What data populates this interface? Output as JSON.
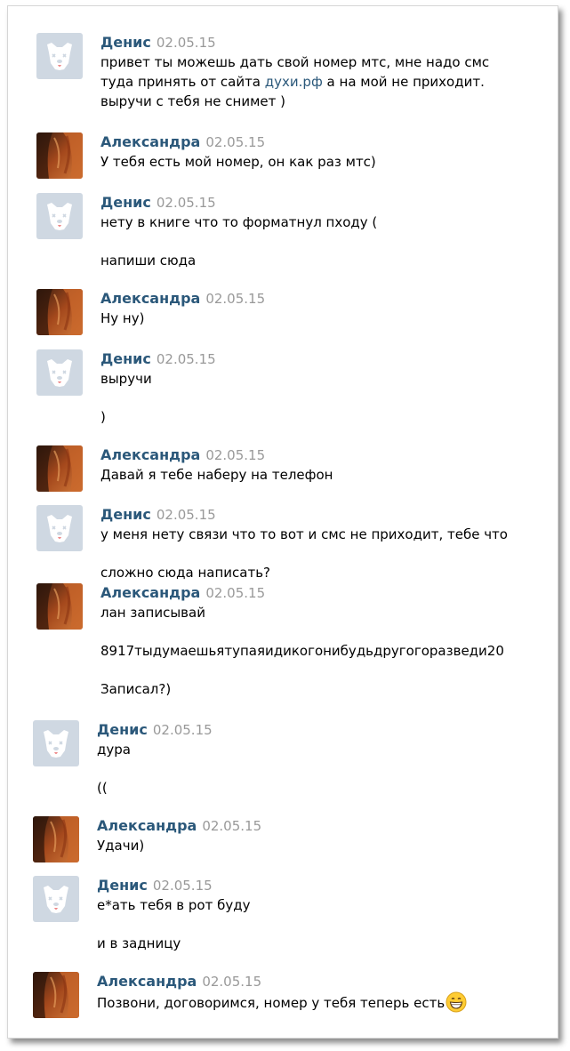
{
  "messages": [
    {
      "author": "Денис",
      "date": "02.05.15",
      "avatar": "default-dog-icon",
      "lines": [
        {
          "text": "привет ты можешь дать свой номер мтс, мне надо смс"
        },
        {
          "pre": "туда принять от сайта ",
          "link": "духи.рф",
          "post": " а на мой не приходит."
        },
        {
          "text": "выручи с тебя не снимет )"
        }
      ]
    },
    {
      "author": "Александра",
      "date": "02.05.15",
      "avatar": "user-photo",
      "lines": [
        {
          "text": "У тебя есть мой номер, он как раз мтс)"
        }
      ]
    },
    {
      "author": "Денис",
      "date": "02.05.15",
      "avatar": "default-dog-icon",
      "lines": [
        {
          "text": "нету в книге что то форматнул пходу ("
        },
        {
          "text": "напиши сюда"
        }
      ]
    },
    {
      "author": "Александра",
      "date": "02.05.15",
      "avatar": "user-photo",
      "lines": [
        {
          "text": "Ну ну)"
        }
      ]
    },
    {
      "author": "Денис",
      "date": "02.05.15",
      "avatar": "default-dog-icon",
      "lines": [
        {
          "text": "выручи"
        },
        {
          "text": ")"
        }
      ]
    },
    {
      "author": "Александра",
      "date": "02.05.15",
      "avatar": "user-photo",
      "lines": [
        {
          "text": "Давай я тебе наберу на телефон"
        }
      ]
    },
    {
      "author": "Денис",
      "date": "02.05.15",
      "avatar": "default-dog-icon",
      "lines": [
        {
          "text": "у меня нету связи что то вот и смс не приходит, тебе что"
        },
        {
          "text": "сложно сюда написать?"
        }
      ]
    },
    {
      "author": "Александра",
      "date": "02.05.15",
      "avatar": "user-photo",
      "lines": [
        {
          "text": "лан записывай"
        },
        {
          "text": "8917тыдумаешьятупаяидикогонибудьдругогоразведи20"
        },
        {
          "text": "Записал?)"
        }
      ]
    },
    {
      "author": "Денис",
      "date": "02.05.15",
      "avatar": "default-dog-icon",
      "lines": [
        {
          "text": "дура"
        },
        {
          "text": "(("
        }
      ]
    },
    {
      "author": "Александра",
      "date": "02.05.15",
      "avatar": "user-photo",
      "lines": [
        {
          "text": "Удачи)"
        }
      ]
    },
    {
      "author": "Денис",
      "date": "02.05.15",
      "avatar": "default-dog-icon",
      "lines": [
        {
          "text": "е*ать тебя в рот буду"
        },
        {
          "text": "и в задницу"
        }
      ]
    },
    {
      "author": "Александра",
      "date": "02.05.15",
      "avatar": "user-photo",
      "lines": [
        {
          "text": "Позвони, договоримся, номер у тебя теперь есть",
          "emoji": "grinning-face-icon"
        }
      ]
    }
  ],
  "colors": {
    "name": "#2b587a",
    "date": "#999999",
    "link": "#2b587a",
    "text": "#000000"
  }
}
